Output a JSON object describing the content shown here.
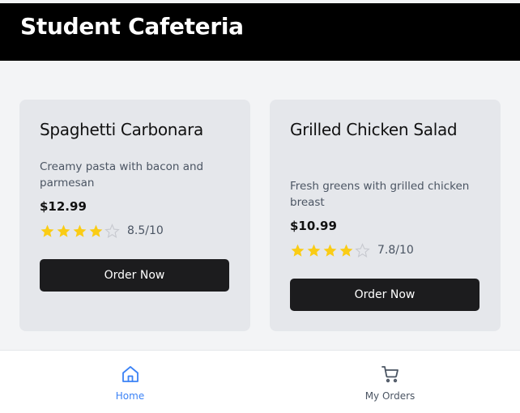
{
  "header": {
    "title": "Student Cafeteria"
  },
  "menu": {
    "items": [
      {
        "name": "Spaghetti Carbonara",
        "description": "Creamy pasta with bacon and parmesan",
        "price": "$12.99",
        "stars": 4,
        "rating_text": "8.5/10",
        "order_label": "Order Now"
      },
      {
        "name": "Grilled Chicken Salad",
        "description": "Fresh greens with grilled chicken breast",
        "price": "$10.99",
        "stars": 4,
        "rating_text": "7.8/10",
        "order_label": "Order Now"
      }
    ]
  },
  "nav": {
    "items": [
      {
        "label": "Home",
        "icon": "home-icon",
        "active": true
      },
      {
        "label": "My Orders",
        "icon": "cart-icon",
        "active": false
      }
    ]
  },
  "colors": {
    "header_bg": "#000000",
    "page_bg": "#f3f4f6",
    "card_bg": "#e5e7eb",
    "button_bg": "#1c1c1e",
    "star_filled": "#facc15",
    "star_empty": "#d1d5db",
    "nav_active": "#3b82f6",
    "nav_inactive": "#4b5563"
  }
}
